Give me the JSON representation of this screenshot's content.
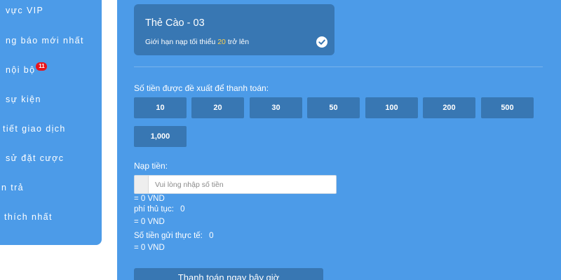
{
  "sidebar": {
    "items": [
      {
        "label": "vực VIP"
      },
      {
        "label": "ng báo mới nhất"
      },
      {
        "label": "nội bộ",
        "badge": "11"
      },
      {
        "label": "sự kiện"
      },
      {
        "label": "tiết giao dịch"
      },
      {
        "label": "sử đặt cược"
      },
      {
        "label": "n trả"
      },
      {
        "label": "thích nhất"
      }
    ]
  },
  "card": {
    "title": "Thẻ Cào - 03",
    "desc_prefix": "Giới hạn nạp tối thiểu",
    "min_amount": "20",
    "desc_suffix": "trở lên",
    "selected": true
  },
  "suggested": {
    "label": "Số tiền được đề xuất để thanh toán:",
    "amounts": [
      "10",
      "20",
      "30",
      "50",
      "100",
      "200",
      "500",
      "1,000"
    ]
  },
  "deposit": {
    "label": "Nạp tiền:",
    "placeholder": "Vui lòng nhập số tiền",
    "converted": "= 0 VND"
  },
  "fee": {
    "label": "phí thủ tục:",
    "value": "0",
    "converted": "= 0 VND"
  },
  "actual": {
    "label": "Số tiền gửi thực tế:",
    "value": "0",
    "converted": "= 0 VND"
  },
  "pay_button": "Thanh toán ngay bây giờ",
  "colors": {
    "panel": "#4c9be8",
    "button": "#3877b3",
    "highlight": "#ffd24c",
    "badge": "#e8141c"
  }
}
